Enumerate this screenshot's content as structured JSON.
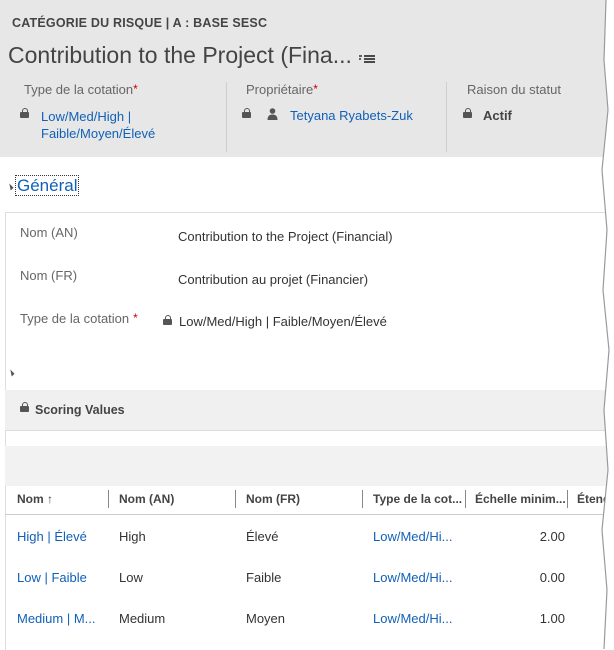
{
  "header": {
    "entity_label": "CATÉGORIE DU RISQUE | A : BASE SESC",
    "record_title": "Contribution to the Project (Fina...",
    "fields": [
      {
        "label": "Type de la cotation",
        "required": "*",
        "value_line1": "Low/Med/High |",
        "value_line2": "Faible/Moyen/Élevé"
      },
      {
        "label": "Propriétaire",
        "required": "*",
        "value": "Tetyana Ryabets-Zuk"
      },
      {
        "label": "Raison du statut",
        "value": "Actif"
      }
    ]
  },
  "section": {
    "title": "Général",
    "fields": [
      {
        "label": "Nom (AN)",
        "value": "Contribution to the Project (Financial)"
      },
      {
        "label": "Nom (FR)",
        "value": "Contribution au projet (Financier)"
      },
      {
        "label": "Type de la cotation",
        "required": "*",
        "value": "Low/Med/High | Faible/Moyen/Élevé"
      }
    ]
  },
  "subgrid": {
    "title": "Scoring Values",
    "columns": [
      "Nom ↑",
      "Nom (AN)",
      "Nom (FR)",
      "Type de la cot...",
      "Échelle minim...",
      "Étend"
    ],
    "rows": [
      {
        "nom": "High | Élevé",
        "nom_an": "High",
        "nom_fr": "Élevé",
        "type": "Low/Med/Hi...",
        "echelle": "2.00"
      },
      {
        "nom": "Low | Faible",
        "nom_an": "Low",
        "nom_fr": "Faible",
        "type": "Low/Med/Hi...",
        "echelle": "0.00"
      },
      {
        "nom": "Medium | M...",
        "nom_an": "Medium",
        "nom_fr": "Moyen",
        "type": "Low/Med/Hi...",
        "echelle": "1.00"
      }
    ]
  },
  "colors": {
    "header_bg": "#e7e7e7",
    "link": "#1160b7",
    "required": "#cc0000"
  }
}
